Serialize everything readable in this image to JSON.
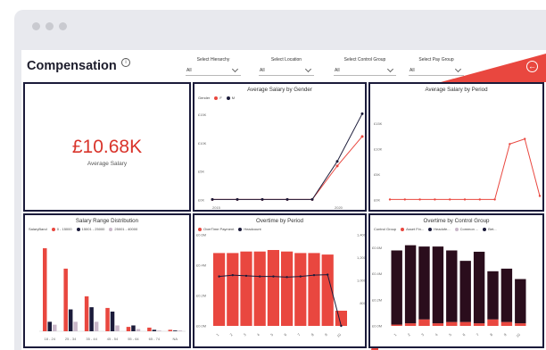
{
  "report": {
    "title": "Compensation",
    "filters": [
      {
        "label": "Select Hierarchy",
        "value": "All"
      },
      {
        "label": "Select Location",
        "value": "All"
      },
      {
        "label": "Select Control Group",
        "value": "All"
      },
      {
        "label": "Select Pay Group",
        "value": "All"
      }
    ],
    "colors": {
      "accent": "#e9473f",
      "dark": "#1b1b3a",
      "bar_dark": "#2a0d1c"
    }
  },
  "kpi": {
    "value": "£10.68K",
    "label": "Average Salary"
  },
  "gender_chart": {
    "title": "Average Salary by Gender",
    "legend": [
      {
        "label": "Gender",
        "color": ""
      },
      {
        "label": "F",
        "color": "#e9473f"
      },
      {
        "label": "M",
        "color": "#1b1b3a"
      }
    ]
  },
  "period_chart": {
    "title": "Average Salary by Period"
  },
  "range_chart": {
    "title": "Salary Range Distribution",
    "legend": [
      {
        "label": "SalaryBand",
        "color": ""
      },
      {
        "label": "0 - 15000",
        "color": "#e9473f"
      },
      {
        "label": "15001 - 25000",
        "color": "#1b1b3a"
      },
      {
        "label": "25001 - 40000",
        "color": "#c9b7c9"
      }
    ]
  },
  "overtime_chart": {
    "title": "Overtime by Period",
    "legend": [
      {
        "label": "OverTime Payment",
        "color": "#e9473f"
      },
      {
        "label": "Headcount",
        "color": "#1b1b3a"
      }
    ]
  },
  "control_chart": {
    "title": "Overtime by Control Group",
    "legend": [
      {
        "label": "Control Group",
        "color": ""
      },
      {
        "label": "Asset Fin...",
        "color": "#e9473f"
      },
      {
        "label": "Headofe...",
        "color": "#1b1b3a"
      },
      {
        "label": "Common ...",
        "color": "#c9b7c9"
      },
      {
        "label": "Bet...",
        "color": "#1b1b3a"
      }
    ]
  },
  "chart_data": [
    {
      "type": "line",
      "title": "Average Salary by Gender",
      "x": [
        "2015",
        "2016",
        "2017",
        "2018",
        "2019",
        "2020",
        "2021"
      ],
      "series": [
        {
          "name": "F",
          "values": [
            0.09,
            0.09,
            0.09,
            0.09,
            0.09,
            6.0,
            11.2
          ]
        },
        {
          "name": "M",
          "values": [
            0.09,
            0.09,
            0.09,
            0.09,
            0.09,
            6.8,
            15.2
          ]
        }
      ],
      "y_tick_labels": [
        "£0K",
        "£5K",
        "£10K",
        "£15K"
      ],
      "x_tick_labels": [
        "2015",
        "2020"
      ],
      "ylim": [
        0,
        17
      ]
    },
    {
      "type": "line",
      "title": "Average Salary by Period",
      "x": [
        "1",
        "2",
        "3",
        "4",
        "5",
        "6",
        "7",
        "8",
        "9",
        "10",
        "11"
      ],
      "series": [
        {
          "name": "",
          "values": [
            0.1,
            0.1,
            0.1,
            0.1,
            0.1,
            0.1,
            0.1,
            0.1,
            11.0,
            12.0,
            0.8
          ]
        }
      ],
      "y_tick_labels": [
        "£0K",
        "£5K",
        "£10K",
        "£15K"
      ],
      "ylim": [
        0,
        20
      ]
    },
    {
      "type": "bar",
      "title": "Salary Range Distribution",
      "categories": [
        "18 - 24",
        "25 - 34",
        "35 - 44",
        "45 - 54",
        "55 - 64",
        "65 - 74",
        "NA"
      ],
      "series": [
        {
          "name": "0 - 15000",
          "values": [
            114,
            86,
            48,
            32,
            6,
            5,
            2
          ]
        },
        {
          "name": "15001 - 25000",
          "values": [
            13,
            30,
            33,
            27,
            8,
            2,
            1
          ]
        },
        {
          "name": "25001 - 40000",
          "values": [
            9,
            13,
            13,
            8,
            3,
            1,
            1
          ]
        }
      ],
      "ylim": [
        0,
        130
      ]
    },
    {
      "type": "bar",
      "title": "Overtime by Period",
      "categories": [
        "1",
        "2",
        "3",
        "4",
        "5",
        "6",
        "7",
        "8",
        "9",
        "10"
      ],
      "series": [
        {
          "name": "OverTime Payment",
          "values": [
            0.48,
            0.48,
            0.49,
            0.49,
            0.5,
            0.49,
            0.48,
            0.48,
            0.47,
            0.1
          ]
        },
        {
          "name": "Headcount",
          "values": [
            1080,
            1090,
            1085,
            1080,
            1080,
            1075,
            1080,
            1090,
            1094,
            700
          ]
        }
      ],
      "ylim": [
        0,
        0.6
      ],
      "y2lim": [
        0,
        1400
      ],
      "y_tick_labels": [
        "£0.0M",
        "£0.2M",
        "£0.4M",
        "£0.6M"
      ],
      "y2_tick_labels": [
        "1,400",
        "1,200",
        "1,000",
        "800"
      ]
    },
    {
      "type": "bar",
      "title": "Overtime by Control Group",
      "categories": [
        "1",
        "2",
        "3",
        "4",
        "5",
        "6",
        "7",
        "8",
        "9",
        "10"
      ],
      "series": [
        {
          "name": "Asset Fin...",
          "values": [
            0.01,
            0.02,
            0.05,
            0.02,
            0.03,
            0.03,
            0.02,
            0.05,
            0.03,
            0.02
          ]
        },
        {
          "name": "Headofe...",
          "values": [
            0.57,
            0.6,
            0.56,
            0.59,
            0.55,
            0.47,
            0.55,
            0.37,
            0.41,
            0.34
          ]
        }
      ],
      "ylim": [
        0,
        0.7
      ],
      "y_tick_labels": [
        "£0.0M",
        "£0.2M",
        "£0.4M",
        "£0.6M"
      ]
    }
  ]
}
